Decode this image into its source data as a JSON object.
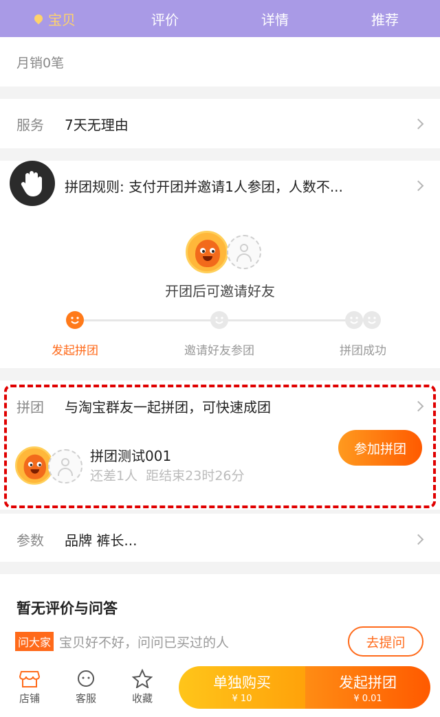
{
  "tabs": [
    {
      "label": "宝贝",
      "active": true
    },
    {
      "label": "评价"
    },
    {
      "label": "详情"
    },
    {
      "label": "推荐"
    }
  ],
  "monthly_sales": "月销0笔",
  "service": {
    "label": "服务",
    "value": "7天无理由"
  },
  "group_rule": {
    "value": "拼团规则: 支付开团并邀请1人参团，人数不..."
  },
  "invite_hint": "开团后可邀请好友",
  "steps": [
    "发起拼团",
    "邀请好友参团",
    "拼团成功"
  ],
  "group": {
    "label": "拼团",
    "value": "与淘宝群友一起拼团，可快速成团",
    "name": "拼团测试001",
    "status": "还差1人  距结束23时26分",
    "join": "参加拼团"
  },
  "params": {
    "label": "参数",
    "value": "品牌 裤长..."
  },
  "qa": {
    "title": "暂无评价与问答",
    "badge": "问大家",
    "text": "宝贝好不好，问问已买过的人",
    "ask": "去提问"
  },
  "bottom": {
    "shop": "店铺",
    "service": "客服",
    "fav": "收藏",
    "single": {
      "label": "单独购买",
      "price": "¥ 10"
    },
    "group": {
      "label": "发起拼团",
      "price": "¥ 0.01"
    }
  },
  "colors": {
    "tabbar": "#a99ae6",
    "accent": "#ff6a1a",
    "active_tab": "#ffd36a"
  }
}
